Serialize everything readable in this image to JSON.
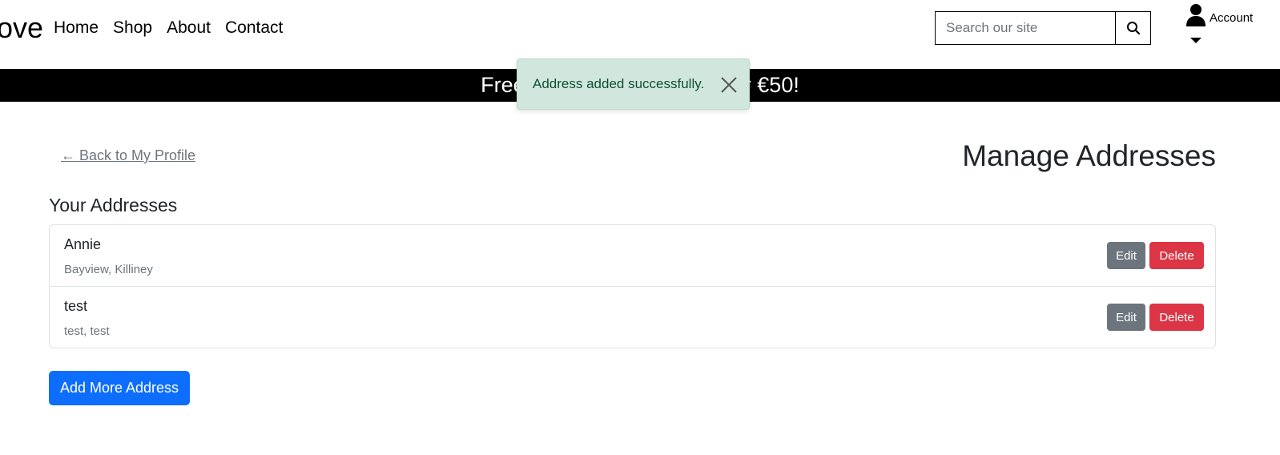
{
  "header": {
    "brand": "ove",
    "nav": [
      "Home",
      "Shop",
      "About",
      "Contact"
    ],
    "search_placeholder": "Search our site",
    "account_label": "Account"
  },
  "banner": {
    "text": "Free delivery on orders over €50!"
  },
  "toast": {
    "message": "Address added successfully."
  },
  "main": {
    "back_link": "← Back to My Profile",
    "page_title": "Manage Addresses",
    "section_title": "Your Addresses",
    "addresses": [
      {
        "name": "Annie",
        "detail": "Bayview, Killiney",
        "edit_label": "Edit",
        "delete_label": "Delete"
      },
      {
        "name": "test",
        "detail": "test, test",
        "edit_label": "Edit",
        "delete_label": "Delete"
      }
    ],
    "add_button": "Add More Address"
  },
  "colors": {
    "primary": "#0d6efd",
    "danger": "#dc3545",
    "secondary": "#6c757d",
    "toast_bg": "#d1e7dd",
    "banner_bg": "#000000"
  }
}
